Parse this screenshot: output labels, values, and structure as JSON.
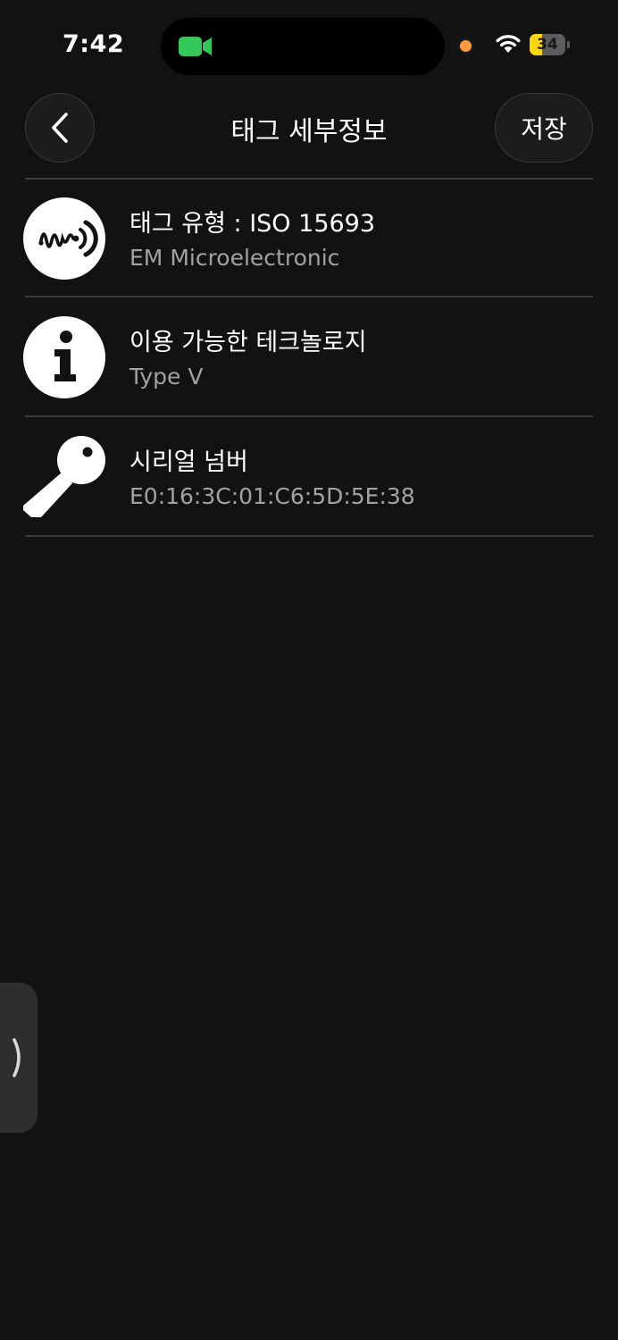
{
  "status_bar": {
    "time": "7:42",
    "battery_level": "34",
    "battery_fraction": 0.34,
    "camera_color": "#34c759",
    "mic_indicator_color": "#ff9a3c"
  },
  "nav": {
    "title": "태그 세부정보",
    "save_label": "저장",
    "back_icon": "chevron-left-icon"
  },
  "rows": [
    {
      "icon": "nfc-signal-icon",
      "title": "태그 유형 : ISO 15693",
      "subtitle": "EM Microelectronic"
    },
    {
      "icon": "info-icon",
      "title": "이용 가능한 테크놀로지",
      "subtitle": "Type V"
    },
    {
      "icon": "key-icon",
      "title": "시리얼 넘버",
      "subtitle": "E0:16:3C:01:C6:5D:5E:38"
    }
  ],
  "side_handle": {
    "icon": "chevron-right-icon"
  },
  "colors": {
    "background": "#121212",
    "divider": "#3a3a3a",
    "subtitle": "#a2a2a2",
    "battery_fill": "#ffd60a"
  }
}
